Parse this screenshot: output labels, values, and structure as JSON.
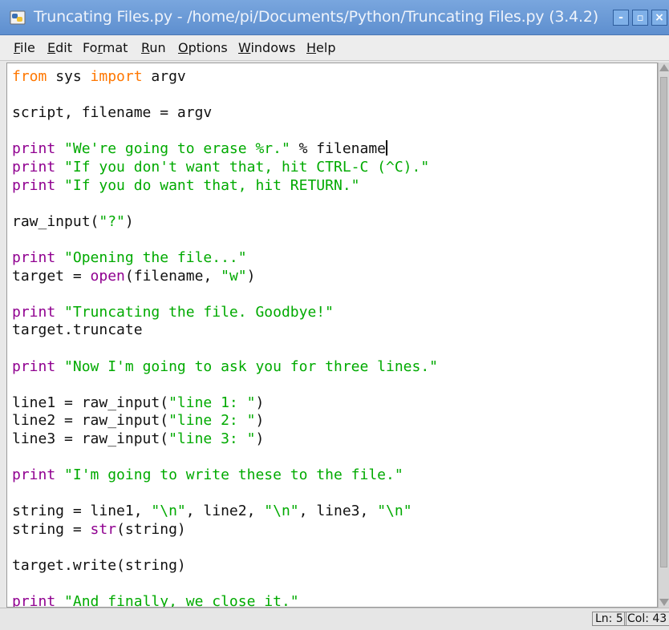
{
  "window": {
    "title": "Truncating Files.py - /home/pi/Documents/Python/Truncating Files.py (3.4.2)",
    "controls": {
      "minimize": "-",
      "maximize": "▫",
      "close": "×"
    }
  },
  "menu": [
    {
      "first": "F",
      "rest": "ile"
    },
    {
      "first": "E",
      "rest": "dit"
    },
    {
      "first": "F",
      "rest": "o",
      "u": "r",
      "tail": "mat"
    },
    {
      "first": "R",
      "rest": "un"
    },
    {
      "first": "O",
      "rest": "ptions"
    },
    {
      "first": "W",
      "rest": "indows"
    },
    {
      "first": "H",
      "rest": "elp"
    }
  ],
  "code": {
    "l1": {
      "a": "from",
      "b": " sys ",
      "c": "import",
      "d": " argv"
    },
    "l3": "script, filename = argv",
    "l5": {
      "kw": "print",
      "str": "\"We're going to erase %r.\"",
      "rest": " % filename"
    },
    "l6": {
      "kw": "print",
      "str": "\"If you don't want that, hit CTRL-C (^C).\""
    },
    "l7": {
      "kw": "print",
      "str": "\"If you do want that, hit RETURN.\""
    },
    "l9": {
      "a": "raw_input(",
      "str": "\"?\"",
      "b": ")"
    },
    "l11": {
      "kw": "print",
      "str": "\"Opening the file...\""
    },
    "l12": {
      "a": "target = ",
      "bi": "open",
      "b": "(filename, ",
      "str": "\"w\"",
      "c": ")"
    },
    "l14": {
      "kw": "print",
      "str": "\"Truncating the file. Goodbye!\""
    },
    "l15": "target.truncate",
    "l17": {
      "kw": "print",
      "str": "\"Now I'm going to ask you for three lines.\""
    },
    "l19": {
      "a": "line1 = raw_input(",
      "str": "\"line 1: \"",
      "b": ")"
    },
    "l20": {
      "a": "line2 = raw_input(",
      "str": "\"line 2: \"",
      "b": ")"
    },
    "l21": {
      "a": "line3 = raw_input(",
      "str": "\"line 3: \"",
      "b": ")"
    },
    "l23": {
      "kw": "print",
      "str": "\"I'm going to write these to the file.\""
    },
    "l25": {
      "a": "string = line1, ",
      "s1": "\"\\n\"",
      "b": ", line2, ",
      "s2": "\"\\n\"",
      "c": ", line3, ",
      "s3": "\"\\n\""
    },
    "l26": {
      "a": "string = ",
      "bi": "str",
      "b": "(string)"
    },
    "l28": "target.write(string)",
    "l30": {
      "kw": "print",
      "str": "\"And finally, we close it.\""
    }
  },
  "status": {
    "line": "Ln: 5",
    "col": "Col: 43"
  },
  "colors": {
    "keyword": "#ff7700",
    "builtin": "#900090",
    "string": "#00aa00"
  },
  "icons": {
    "app": "python-icon"
  }
}
